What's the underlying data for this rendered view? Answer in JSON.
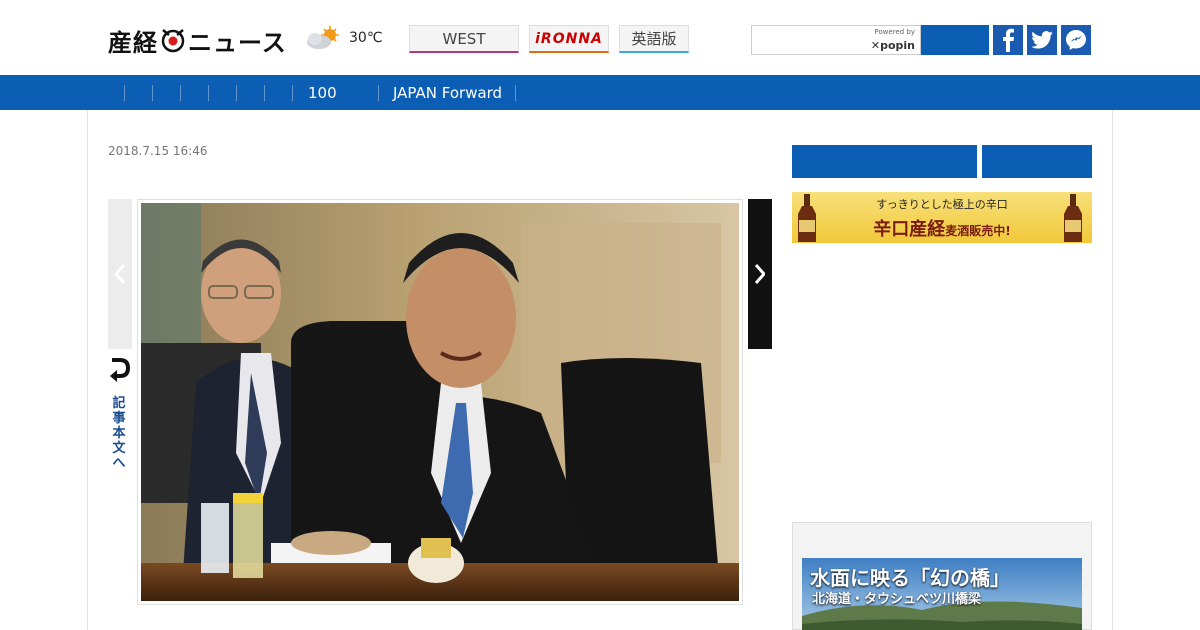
{
  "header": {
    "logo_text_left": "産経",
    "logo_text_right": "ニュース",
    "temperature": "30℃",
    "tabs": [
      {
        "label": "WEST"
      },
      {
        "label": "iRONNA"
      },
      {
        "label": "英語版"
      }
    ],
    "search": {
      "placeholder": "",
      "powered_by": "Powered by",
      "provider": "popin"
    }
  },
  "nav": {
    "items": [
      "100",
      "JAPAN Forward"
    ]
  },
  "article": {
    "date": "2018.7.15 16:46",
    "jump_label": "記事本文へ"
  },
  "sidebar": {
    "ad": {
      "tagline": "すっきりとした極上の辛口",
      "headline": "辛口産経",
      "sub": "麦酒販売中!"
    },
    "promo": {
      "title": "水面に映る「幻の橋」",
      "subtitle": "北海道・タウシュベツ川橋梁"
    }
  },
  "colors": {
    "brand_blue": "#0b5eb3",
    "west_accent": "#b03a7a",
    "ironna_accent": "#e06a10",
    "english_accent": "#3aa7d8"
  }
}
